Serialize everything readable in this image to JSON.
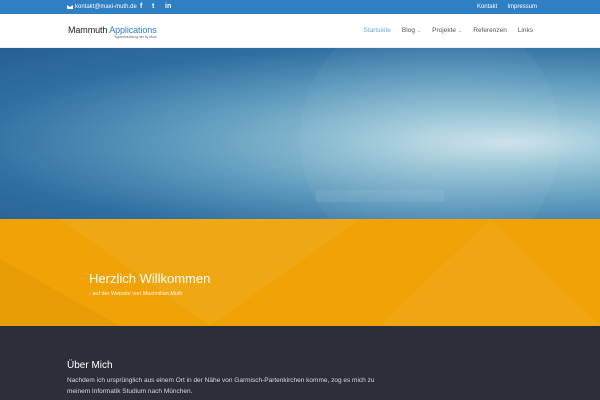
{
  "topbar": {
    "email": "kontakt@maxi-muth.de",
    "social": [
      "f",
      "t",
      "in"
    ],
    "links": [
      "Kontakt",
      "Impressum"
    ]
  },
  "header": {
    "logo": {
      "word1": "Mammuth",
      "word2": "Applications",
      "tagline": "Appentwicklung der by Maxi"
    },
    "nav": [
      {
        "label": "Startseite",
        "active": true,
        "dropdown": false
      },
      {
        "label": "Blog",
        "active": false,
        "dropdown": true
      },
      {
        "label": "Projekte",
        "active": false,
        "dropdown": true
      },
      {
        "label": "Referenzen",
        "active": false,
        "dropdown": false
      },
      {
        "label": "Links",
        "active": false,
        "dropdown": false
      }
    ]
  },
  "welcome": {
    "title": "Herzlich Willkommen",
    "subtitle": "- auf der Website von Maximilian Muth"
  },
  "about": {
    "title": "Über Mich",
    "text": "Nachdem ich ursprünglich aus einem Ort in der Nähe von Garmisch-Partenkirchen komme, zog es mich zu meinem Informatik Studium nach München."
  },
  "colors": {
    "topbar": "#2e7fc4",
    "accent": "#6aa7d6",
    "welcome": "#f0a206",
    "about": "#2c2f3a"
  }
}
